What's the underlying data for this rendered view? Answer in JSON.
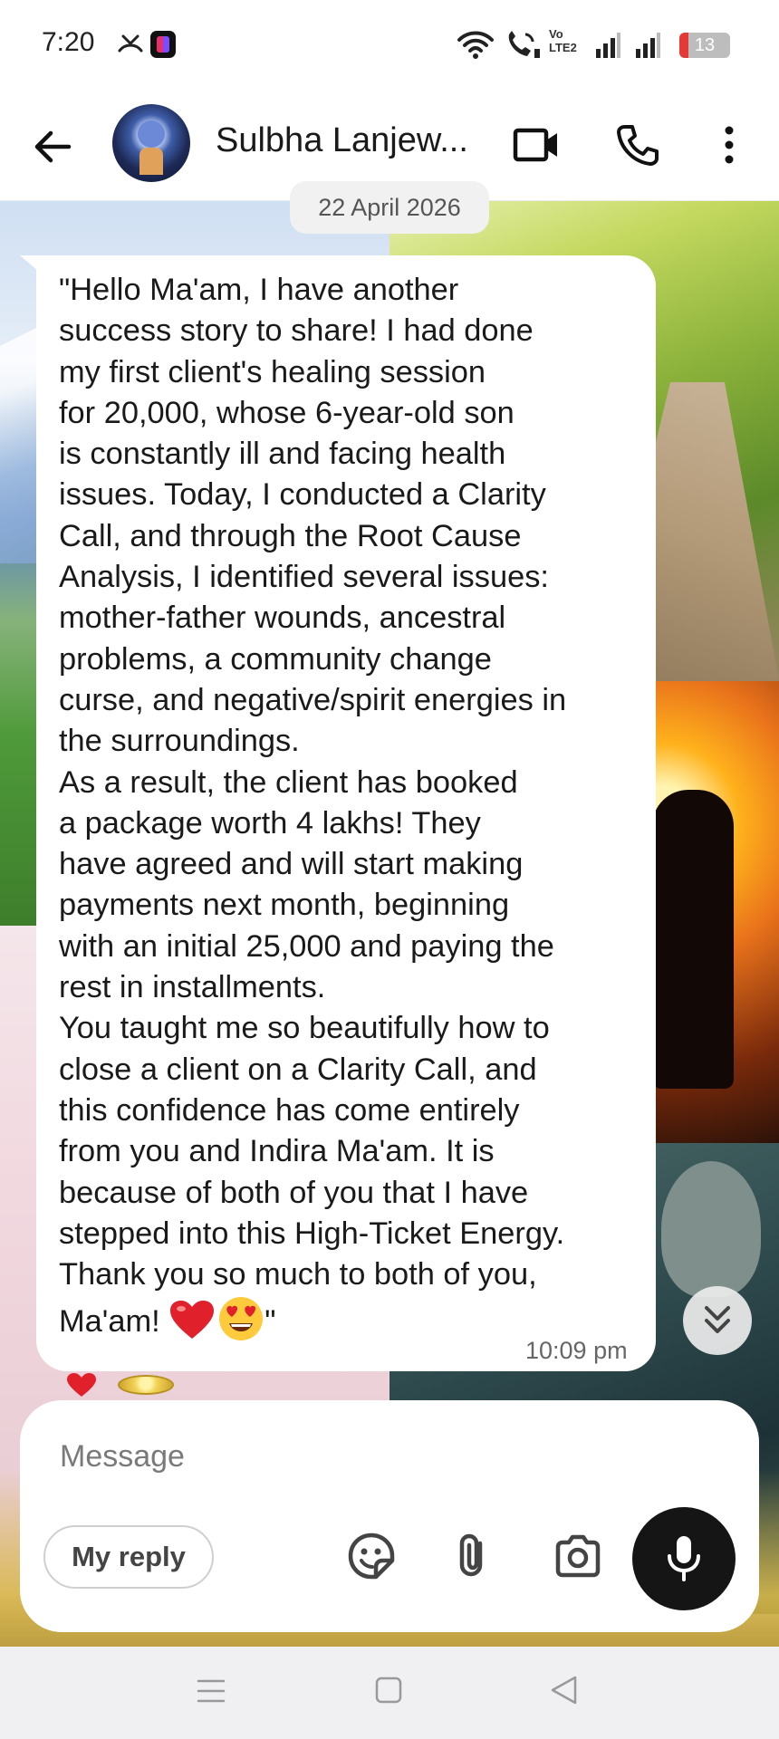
{
  "status_bar": {
    "time": "7:20",
    "network_badge": "Vo\nLTE2",
    "battery": "13",
    "battery_color": "#e53935"
  },
  "header": {
    "contact_name": "Sulbha Lanjew...",
    "icons": [
      "back-arrow-icon",
      "avatar",
      "video-call-icon",
      "phone-icon",
      "more-vertical-icon"
    ]
  },
  "conversation": {
    "date_label": "22 April 2026",
    "message": {
      "text": "\"Hello Ma'am, I have another\nsuccess story to share! I had done\nmy first client's healing session\nfor 20,000, whose 6-year-old son\nis constantly ill and facing health\nissues. Today, I conducted a Clarity\nCall, and through the Root Cause\nAnalysis, I identified several issues:\nmother-father wounds, ancestral\nproblems, a community change\ncurse, and negative/spirit energies in\nthe surroundings.\nAs a result, the client has booked\na package worth 4 lakhs! They\nhave agreed and will start making\npayments next month, beginning\nwith an initial 25,000 and paying the\nrest in installments.\nYou taught me so beautifully how to\nclose a client on a Clarity Call, and\nthis confidence has come entirely\nfrom you and Indira Ma'am. It is\nbecause of both of you that I have\nstepped into this High-Ticket Energy.\nThank you so much to both of you,\nMa'am! ",
      "emojis": [
        "red-heart",
        "heart-eyes-face"
      ],
      "closing_quote": "\"",
      "time": "10:09 pm"
    }
  },
  "composer": {
    "placeholder": "Message",
    "value": "",
    "my_reply_label": "My reply"
  },
  "colors": {
    "mic_button": "#151515",
    "bubble": "#ffffff",
    "navbar": "#f0f0f2"
  }
}
